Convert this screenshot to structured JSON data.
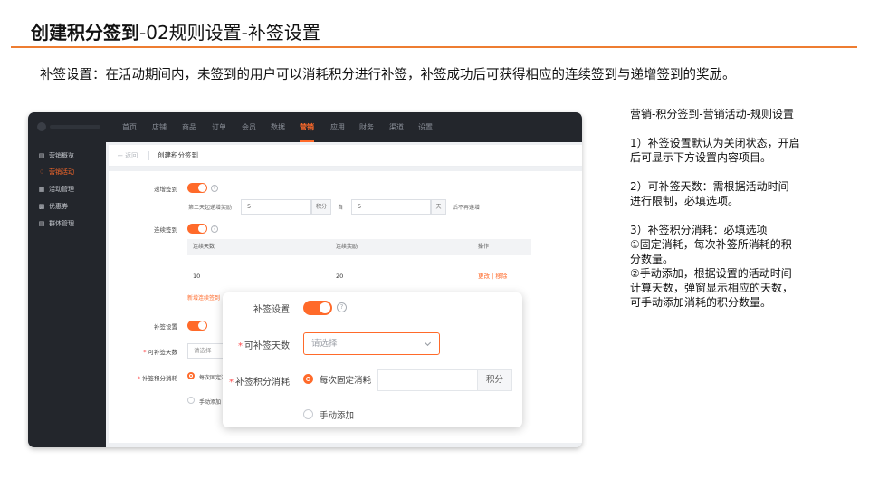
{
  "slide": {
    "title_bold": "创建积分签到",
    "title_rest": "-02规则设置-补签设置",
    "description": "补签设置：在活动期间内，未签到的用户可以消耗积分进行补签，补签成功后可获得相应的连续签到与递增签到的奖励。"
  },
  "notes": {
    "path": "营销-积分签到-营销活动-规则设置",
    "point1": [
      "1）补签设置默认为关闭状态，开启",
      "后可显示下方设置内容项目。"
    ],
    "point2": [
      "2）可补签天数：需根据活动时间",
      "进行限制，必填选项。"
    ],
    "point3": [
      "3）补签积分消耗：必填选项",
      "①固定消耗，每次补签所消耗的积",
      "分数量。",
      "②手动添加，根据设置的活动时间",
      "计算天数，弹窗显示相应的天数，",
      "可手动添加消耗的积分数量。"
    ]
  },
  "app": {
    "nav": [
      "首页",
      "店铺",
      "商品",
      "订单",
      "会员",
      "数据",
      "营销",
      "应用",
      "财务",
      "渠道",
      "设置"
    ],
    "nav_active": "营销",
    "accent_color": "#ff6a2a",
    "sidebar": [
      {
        "icon": "briefcase-icon",
        "label": "营销概览"
      },
      {
        "icon": "tag-icon",
        "label": "营销活动"
      },
      {
        "icon": "grid-icon",
        "label": "活动管理"
      },
      {
        "icon": "ticket-icon",
        "label": "优惠券"
      },
      {
        "icon": "group-icon",
        "label": "群体管理"
      }
    ],
    "sidebar_active": "营销活动",
    "page": {
      "back": "← 返回",
      "title": "创建积分签到"
    },
    "form": {
      "increment_label": "递增签到",
      "increment_text1": "第二天起递增奖励",
      "increment_value1": "5",
      "increment_unit1": "积分",
      "increment_mid": "自",
      "increment_value2": "5",
      "increment_unit2": "天",
      "increment_text2": "后不再递增",
      "continuous_label": "连续签到",
      "table_headers": [
        "连续天数",
        "连续奖励",
        "操作"
      ],
      "table_row": {
        "days": "10",
        "reward": "20",
        "edit": "更改",
        "sep": "|",
        "delete": "移除"
      },
      "add_rule": "新增连续签到",
      "makeup_label": "补签设置",
      "makeup_days_label": "可补签天数",
      "makeup_days_placeholder": "请选择",
      "makeup_cost_label": "补签积分消耗",
      "makeup_cost_option1": "每次固定消",
      "makeup_cost_option2": "手动添加"
    }
  },
  "popup": {
    "makeup_label": "补签设置",
    "makeup_days_label": "可补签天数",
    "makeup_days_placeholder": "请选择",
    "makeup_cost_label": "补签积分消耗",
    "option_fixed": "每次固定消耗",
    "option_fixed_unit": "积分",
    "option_manual": "手动添加"
  }
}
